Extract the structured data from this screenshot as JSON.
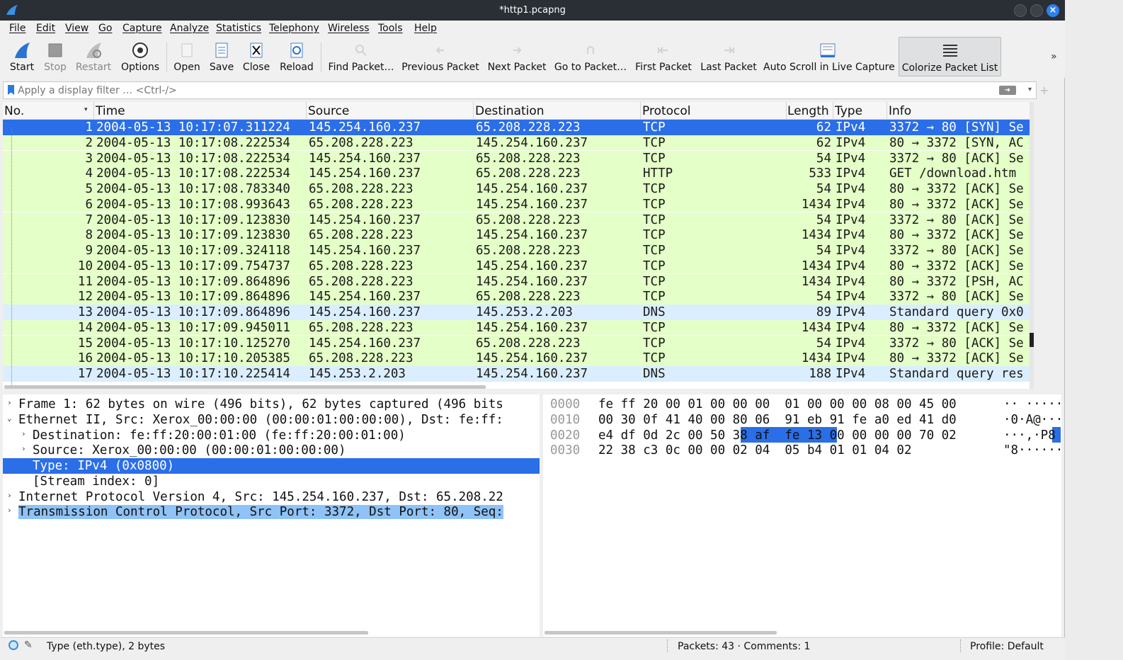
{
  "window": {
    "title": "*http1.pcapng"
  },
  "menu": [
    "File",
    "Edit",
    "View",
    "Go",
    "Capture",
    "Analyze",
    "Statistics",
    "Telephony",
    "Wireless",
    "Tools",
    "Help"
  ],
  "toolbar": {
    "start": "Start",
    "stop": "Stop",
    "restart": "Restart",
    "options": "Options",
    "open": "Open",
    "save": "Save",
    "close": "Close",
    "reload": "Reload",
    "find": "Find Packet…",
    "prev": "Previous Packet",
    "next": "Next Packet",
    "goto": "Go to Packet…",
    "first": "First Packet",
    "last": "Last Packet",
    "autoscroll": "Auto Scroll in Live Capture",
    "colorize": "Colorize Packet List",
    "more": "»"
  },
  "filter": {
    "placeholder": "Apply a display filter … <Ctrl-/>"
  },
  "columns": {
    "no": "No.",
    "time": "Time",
    "source": "Source",
    "destination": "Destination",
    "protocol": "Protocol",
    "length": "Length",
    "type": "Type",
    "info": "Info"
  },
  "packets": [
    {
      "no": "1",
      "time": "2004-05-13 10:17:07.311224",
      "src": "145.254.160.237",
      "dst": "65.208.228.223",
      "proto": "TCP",
      "len": "62",
      "type": "IPv4",
      "info": "3372 → 80 [SYN] Se",
      "cls": "tcp"
    },
    {
      "no": "2",
      "time": "2004-05-13 10:17:08.222534",
      "src": "65.208.228.223",
      "dst": "145.254.160.237",
      "proto": "TCP",
      "len": "62",
      "type": "IPv4",
      "info": "80 → 3372 [SYN, AC",
      "cls": "tcp"
    },
    {
      "no": "3",
      "time": "2004-05-13 10:17:08.222534",
      "src": "145.254.160.237",
      "dst": "65.208.228.223",
      "proto": "TCP",
      "len": "54",
      "type": "IPv4",
      "info": "3372 → 80 [ACK] Se",
      "cls": "tcp"
    },
    {
      "no": "4",
      "time": "2004-05-13 10:17:08.222534",
      "src": "145.254.160.237",
      "dst": "65.208.228.223",
      "proto": "HTTP",
      "len": "533",
      "type": "IPv4",
      "info": "GET /download.htm",
      "cls": "http"
    },
    {
      "no": "5",
      "time": "2004-05-13 10:17:08.783340",
      "src": "65.208.228.223",
      "dst": "145.254.160.237",
      "proto": "TCP",
      "len": "54",
      "type": "IPv4",
      "info": "80 → 3372 [ACK] Se",
      "cls": "tcp"
    },
    {
      "no": "6",
      "time": "2004-05-13 10:17:08.993643",
      "src": "65.208.228.223",
      "dst": "145.254.160.237",
      "proto": "TCP",
      "len": "1434",
      "type": "IPv4",
      "info": "80 → 3372 [ACK] Se",
      "cls": "tcp"
    },
    {
      "no": "7",
      "time": "2004-05-13 10:17:09.123830",
      "src": "145.254.160.237",
      "dst": "65.208.228.223",
      "proto": "TCP",
      "len": "54",
      "type": "IPv4",
      "info": "3372 → 80 [ACK] Se",
      "cls": "tcp"
    },
    {
      "no": "8",
      "time": "2004-05-13 10:17:09.123830",
      "src": "65.208.228.223",
      "dst": "145.254.160.237",
      "proto": "TCP",
      "len": "1434",
      "type": "IPv4",
      "info": "80 → 3372 [ACK] Se",
      "cls": "tcp"
    },
    {
      "no": "9",
      "time": "2004-05-13 10:17:09.324118",
      "src": "145.254.160.237",
      "dst": "65.208.228.223",
      "proto": "TCP",
      "len": "54",
      "type": "IPv4",
      "info": "3372 → 80 [ACK] Se",
      "cls": "tcp"
    },
    {
      "no": "10",
      "time": "2004-05-13 10:17:09.754737",
      "src": "65.208.228.223",
      "dst": "145.254.160.237",
      "proto": "TCP",
      "len": "1434",
      "type": "IPv4",
      "info": "80 → 3372 [ACK] Se",
      "cls": "tcp"
    },
    {
      "no": "11",
      "time": "2004-05-13 10:17:09.864896",
      "src": "65.208.228.223",
      "dst": "145.254.160.237",
      "proto": "TCP",
      "len": "1434",
      "type": "IPv4",
      "info": "80 → 3372 [PSH, AC",
      "cls": "tcp"
    },
    {
      "no": "12",
      "time": "2004-05-13 10:17:09.864896",
      "src": "145.254.160.237",
      "dst": "65.208.228.223",
      "proto": "TCP",
      "len": "54",
      "type": "IPv4",
      "info": "3372 → 80 [ACK] Se",
      "cls": "tcp"
    },
    {
      "no": "13",
      "time": "2004-05-13 10:17:09.864896",
      "src": "145.254.160.237",
      "dst": "145.253.2.203",
      "proto": "DNS",
      "len": "89",
      "type": "IPv4",
      "info": "Standard query 0x0",
      "cls": "dns"
    },
    {
      "no": "14",
      "time": "2004-05-13 10:17:09.945011",
      "src": "65.208.228.223",
      "dst": "145.254.160.237",
      "proto": "TCP",
      "len": "1434",
      "type": "IPv4",
      "info": "80 → 3372 [ACK] Se",
      "cls": "tcp"
    },
    {
      "no": "15",
      "time": "2004-05-13 10:17:10.125270",
      "src": "145.254.160.237",
      "dst": "65.208.228.223",
      "proto": "TCP",
      "len": "54",
      "type": "IPv4",
      "info": "3372 → 80 [ACK] Se",
      "cls": "tcp"
    },
    {
      "no": "16",
      "time": "2004-05-13 10:17:10.205385",
      "src": "65.208.228.223",
      "dst": "145.254.160.237",
      "proto": "TCP",
      "len": "1434",
      "type": "IPv4",
      "info": "80 → 3372 [ACK] Se",
      "cls": "tcp"
    },
    {
      "no": "17",
      "time": "2004-05-13 10:17:10.225414",
      "src": "145.253.2.203",
      "dst": "145.254.160.237",
      "proto": "DNS",
      "len": "188",
      "type": "IPv4",
      "info": "Standard query res",
      "cls": "dns"
    }
  ],
  "details": [
    {
      "tw": "›",
      "text": "Frame 1: 62 bytes on wire (496 bits), 62 bytes captured (496 bits",
      "cls": ""
    },
    {
      "tw": "⌄",
      "text": "Ethernet II, Src: Xerox_00:00:00 (00:00:01:00:00:00), Dst: fe:ff:",
      "cls": ""
    },
    {
      "tw": "›",
      "text": "Destination: fe:ff:20:00:01:00 (fe:ff:20:00:01:00)",
      "cls": "",
      "indent": 1
    },
    {
      "tw": "›",
      "text": "Source: Xerox_00:00:00 (00:00:01:00:00:00)",
      "cls": "",
      "indent": 1
    },
    {
      "tw": "",
      "text": "Type: IPv4 (0x0800)",
      "cls": "sel",
      "indent": 1
    },
    {
      "tw": "",
      "text": "[Stream index: 0]",
      "cls": "",
      "indent": 1
    },
    {
      "tw": "›",
      "text": "Internet Protocol Version 4, Src: 145.254.160.237, Dst: 65.208.22",
      "cls": ""
    },
    {
      "tw": "›",
      "text": "Transmission Control Protocol, Src Port: 3372, Dst Port: 80, Seq:",
      "cls": "hl"
    }
  ],
  "bytes": [
    {
      "off": "0000",
      "hex": "fe ff 20 00 01 00 00 00  01 00 00 00 08 00 45 00",
      "ascii": "·· ·····"
    },
    {
      "off": "0010",
      "hex": "00 30 0f 41 40 00 80 06  91 eb 91 fe a0 ed 41 d0",
      "ascii": "·0·A@···"
    },
    {
      "off": "0020",
      "hex": "e4 df 0d 2c 00 50 38 af  fe 13 00 00 00 00 70 02",
      "ascii": "···,·P8"
    },
    {
      "off": "0030",
      "hex": "22 38 c3 0c 00 00 02 04  05 b4 01 01 04 02",
      "ascii": "\"8······"
    }
  ],
  "status": {
    "field": "Type (eth.type), 2 bytes",
    "packets": "Packets: 43 · Comments: 1",
    "profile": "Profile: Default"
  }
}
